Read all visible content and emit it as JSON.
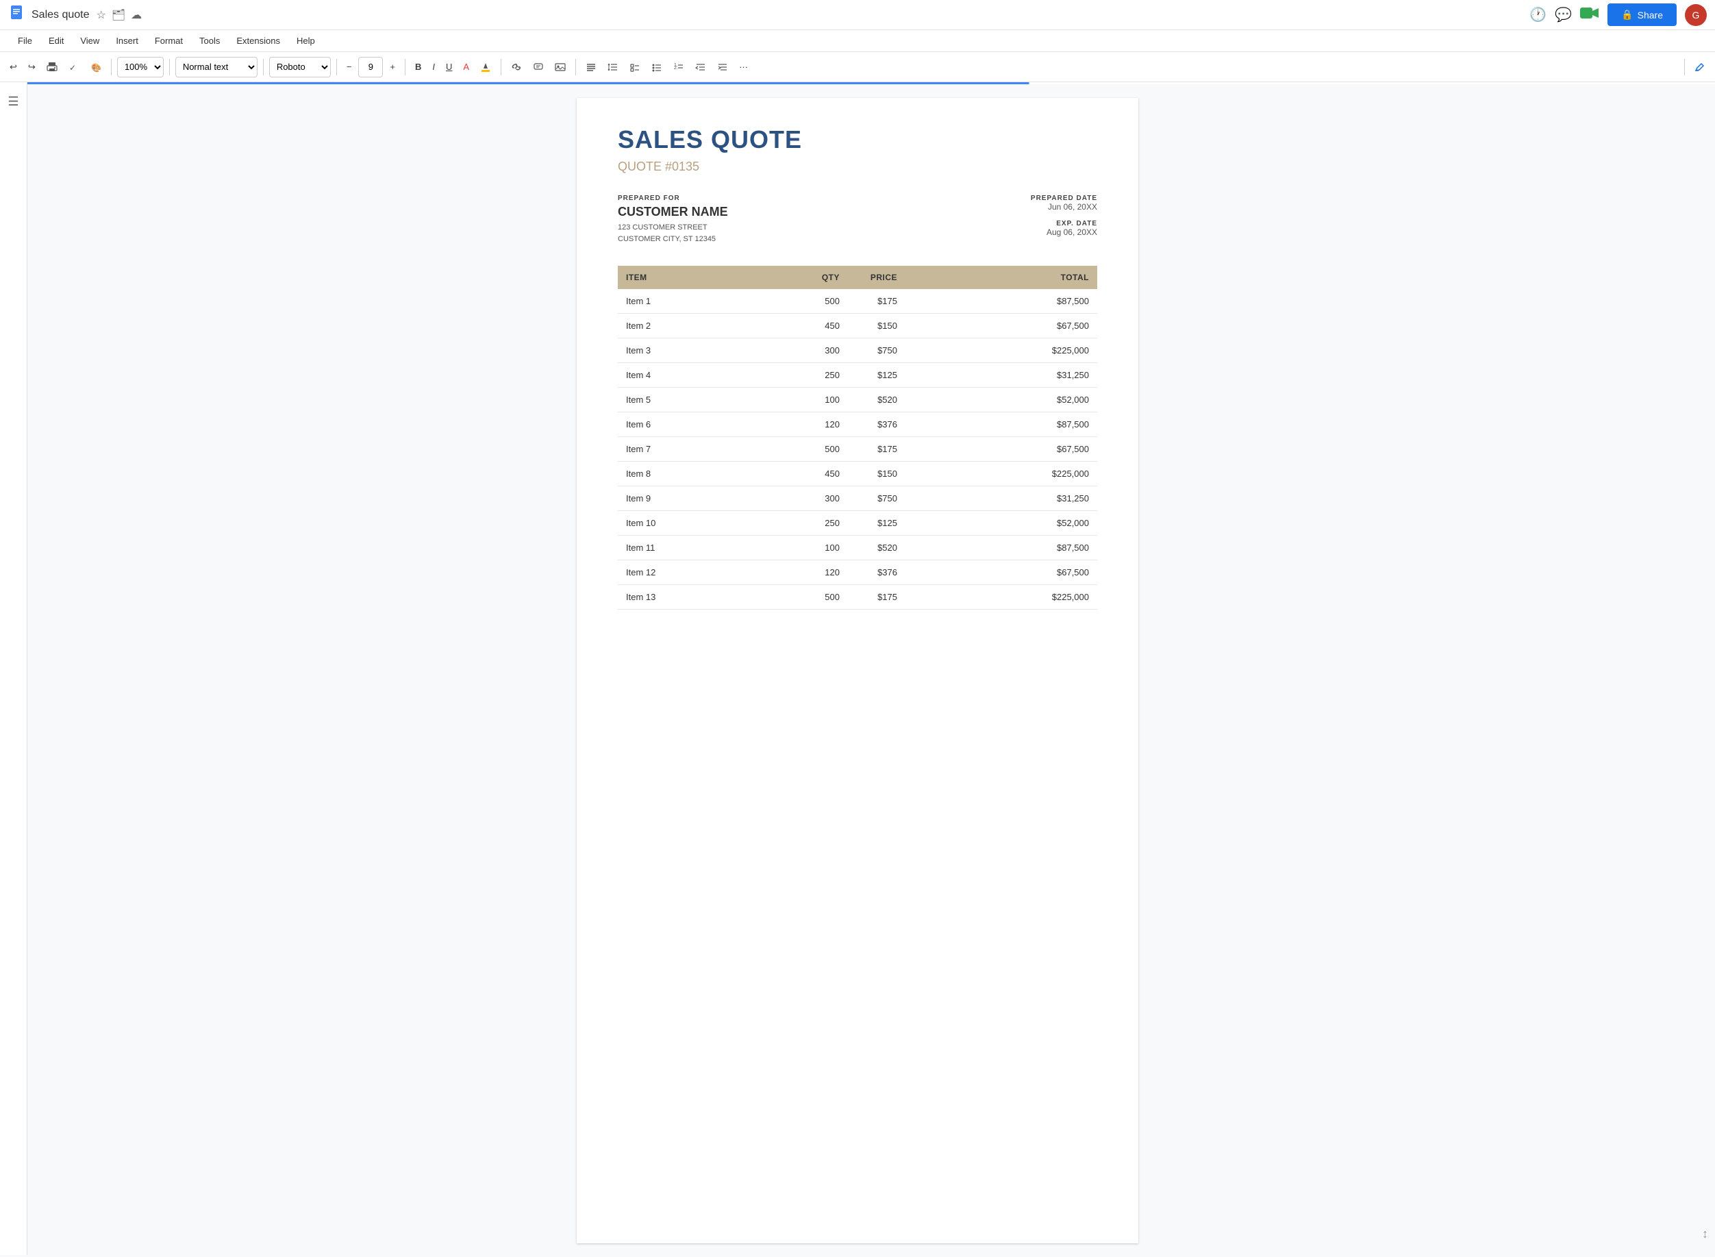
{
  "titleBar": {
    "docTitle": "Sales quote",
    "docIcon": "📄",
    "starIcon": "★",
    "folderIcon": "🗂",
    "cloudIcon": "☁"
  },
  "topRight": {
    "shareLabel": "Share",
    "historyIcon": "🕐",
    "commentIcon": "💬",
    "meetIcon": "📹",
    "avatarInitial": "G"
  },
  "menuBar": {
    "items": [
      "File",
      "Edit",
      "View",
      "Insert",
      "Format",
      "Tools",
      "Extensions",
      "Help"
    ]
  },
  "toolbar": {
    "undo": "↩",
    "redo": "↪",
    "print": "🖨",
    "paintFormat": "🖌",
    "zoom": "100%",
    "normalText": "Normal text",
    "fontFamily": "Roboto",
    "decreaseFont": "−",
    "fontSize": "9",
    "increaseFont": "+",
    "boldLabel": "B",
    "italicLabel": "I",
    "underlineLabel": "U",
    "fontColorLabel": "A",
    "highlightLabel": "🖍",
    "linkLabel": "🔗",
    "commentLabel": "💬",
    "imageLabel": "🖼",
    "alignLabel": "≡",
    "lineSpacingLabel": "↕",
    "checklistLabel": "☑",
    "bulletLabel": "•",
    "numberedLabel": "1.",
    "indentDecLabel": "⇤",
    "indentIncLabel": "⇥",
    "moreLabel": "···",
    "penLabel": "✏"
  },
  "document": {
    "title": "SALES QUOTE",
    "quoteNumber": "QUOTE #0135",
    "preparedForLabel": "PREPARED FOR",
    "customerName": "CUSTOMER NAME",
    "customerStreet": "123 CUSTOMER STREET",
    "customerCity": "CUSTOMER CITY, ST 12345",
    "preparedDateLabel": "PREPARED DATE",
    "preparedDateValue": "Jun 06, 20XX",
    "expDateLabel": "EXP. DATE",
    "expDateValue": "Aug 06, 20XX",
    "table": {
      "headers": [
        "ITEM",
        "QTY",
        "PRICE",
        "",
        "TOTAL"
      ],
      "rows": [
        {
          "item": "Item 1",
          "qty": "500",
          "price": "$175",
          "desc": "",
          "total": "$87,500"
        },
        {
          "item": "Item 2",
          "qty": "450",
          "price": "$150",
          "desc": "",
          "total": "$67,500"
        },
        {
          "item": "Item 3",
          "qty": "300",
          "price": "$750",
          "desc": "",
          "total": "$225,000"
        },
        {
          "item": "Item 4",
          "qty": "250",
          "price": "$125",
          "desc": "",
          "total": "$31,250"
        },
        {
          "item": "Item 5",
          "qty": "100",
          "price": "$520",
          "desc": "",
          "total": "$52,000"
        },
        {
          "item": "Item 6",
          "qty": "120",
          "price": "$376",
          "desc": "",
          "total": "$87,500"
        },
        {
          "item": "Item 7",
          "qty": "500",
          "price": "$175",
          "desc": "",
          "total": "$67,500"
        },
        {
          "item": "Item 8",
          "qty": "450",
          "price": "$150",
          "desc": "",
          "total": "$225,000"
        },
        {
          "item": "Item 9",
          "qty": "300",
          "price": "$750",
          "desc": "",
          "total": "$31,250"
        },
        {
          "item": "Item 10",
          "qty": "250",
          "price": "$125",
          "desc": "",
          "total": "$52,000"
        },
        {
          "item": "Item 11",
          "qty": "100",
          "price": "$520",
          "desc": "",
          "total": "$87,500"
        },
        {
          "item": "Item 12",
          "qty": "120",
          "price": "$376",
          "desc": "",
          "total": "$67,500"
        },
        {
          "item": "Item 13",
          "qty": "500",
          "price": "$175",
          "desc": "",
          "total": "$225,000"
        }
      ]
    }
  }
}
